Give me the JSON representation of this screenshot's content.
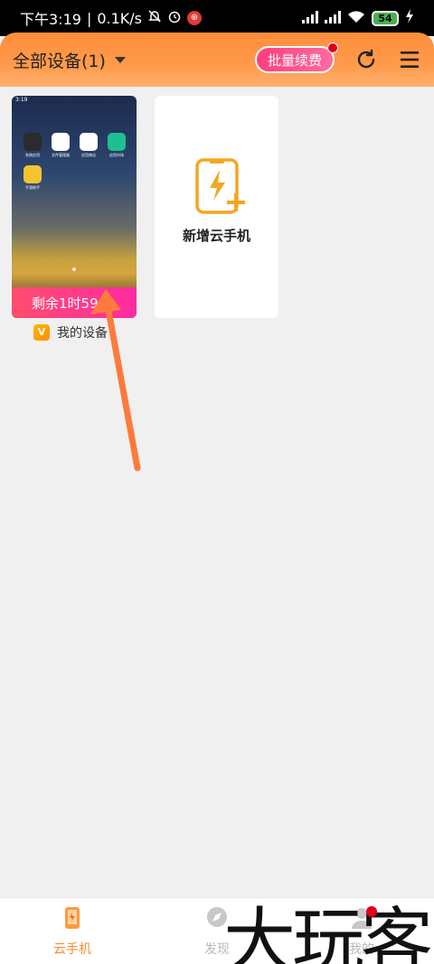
{
  "status_bar": {
    "time": "下午3:19",
    "network_speed": "0.1K/s",
    "battery": "54"
  },
  "header": {
    "title": "全部设备(1)",
    "batch_renew": "批量续费"
  },
  "device_card": {
    "mini_time": "3:19",
    "remaining": "剩余1时59分",
    "apps": [
      "系统应用",
      "文件管理器",
      "应用商店",
      "应用市场",
      "手游助手"
    ],
    "name": "我的设备",
    "vip_badge": "V"
  },
  "add_card": {
    "label": "新增云手机"
  },
  "bottom_nav": {
    "items": [
      {
        "label": "云手机",
        "active": true
      },
      {
        "label": "发现",
        "active": false
      },
      {
        "label": "我的",
        "active": false
      }
    ]
  },
  "watermark": {
    "text": "大玩客"
  },
  "colors": {
    "header_accent": "#ff8e3c",
    "renew_pink": "#ff3e7a",
    "nav_active": "#ff8a2a",
    "arrow": "#ff7a3d"
  }
}
